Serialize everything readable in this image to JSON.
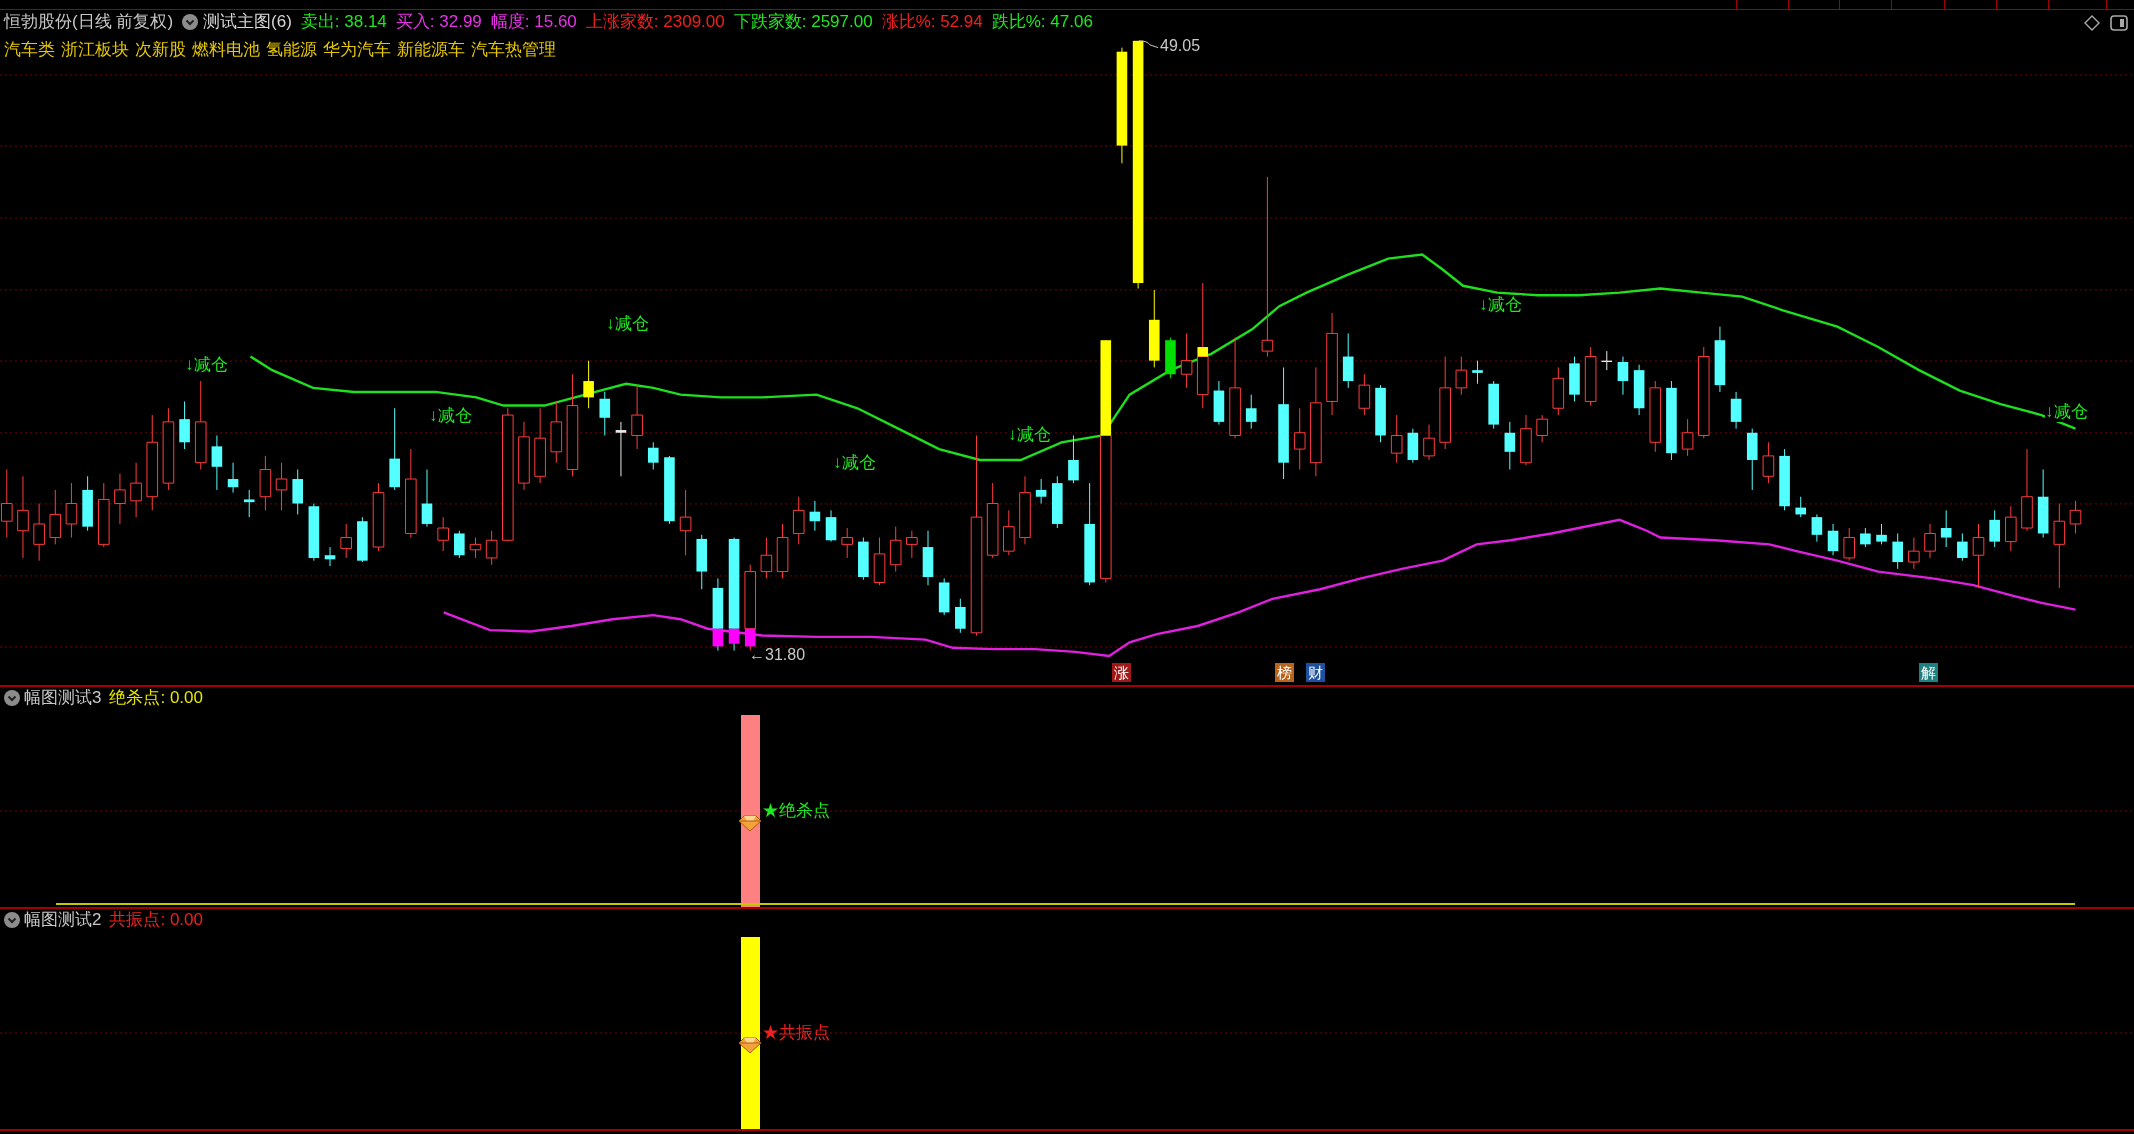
{
  "main_panel": {
    "title": "恒勃股份(日线 前复权)",
    "indicator": "测试主图(6)",
    "readouts": [
      {
        "text": "卖出: 38.14",
        "color": "#1ee81e"
      },
      {
        "text": "买入: 32.99",
        "color": "#e832e8"
      },
      {
        "text": "幅度: 15.60",
        "color": "#e832e8"
      },
      {
        "text": "上涨家数: 2309.00",
        "color": "#f02020"
      },
      {
        "text": "下跌家数: 2597.00",
        "color": "#1ee81e"
      },
      {
        "text": "涨比%: 52.94",
        "color": "#f02020"
      },
      {
        "text": "跌比%: 47.06",
        "color": "#1ee81e"
      }
    ],
    "sectors": [
      "汽车类",
      "浙江板块",
      "次新股",
      "燃料电池",
      "氢能源",
      "华为汽车",
      "新能源车",
      "汽车热管理"
    ],
    "signal_labels": [
      "↓减仓",
      "↓减仓",
      "↓减仓",
      "↓减仓",
      "↓减仓",
      "↓减仓",
      "↓减仓"
    ],
    "high_price_label": "49.05",
    "low_price_label": "←31.80",
    "event_markers": [
      {
        "text": "涨",
        "color": "#a01818"
      },
      {
        "text": "榜",
        "color": "#b8641e"
      },
      {
        "text": "财",
        "color": "#1e50a0"
      },
      {
        "text": "解",
        "color": "#1e8080"
      }
    ]
  },
  "sub_panels": [
    {
      "title": "幅图测试3",
      "readout": {
        "text": "绝杀点: 0.00",
        "color": "#e6e600"
      },
      "signal": {
        "text": "★绝杀点",
        "color": "#1ee81e"
      },
      "bar": {
        "color": "#ff8080"
      },
      "baseline": true
    },
    {
      "title": "幅图测试2",
      "readout": {
        "text": "共振点: 0.00",
        "color": "#f02020"
      },
      "signal": {
        "text": "★共振点",
        "color": "#f02020"
      },
      "bar": {
        "color": "#ffff00"
      },
      "baseline": false
    }
  ]
}
